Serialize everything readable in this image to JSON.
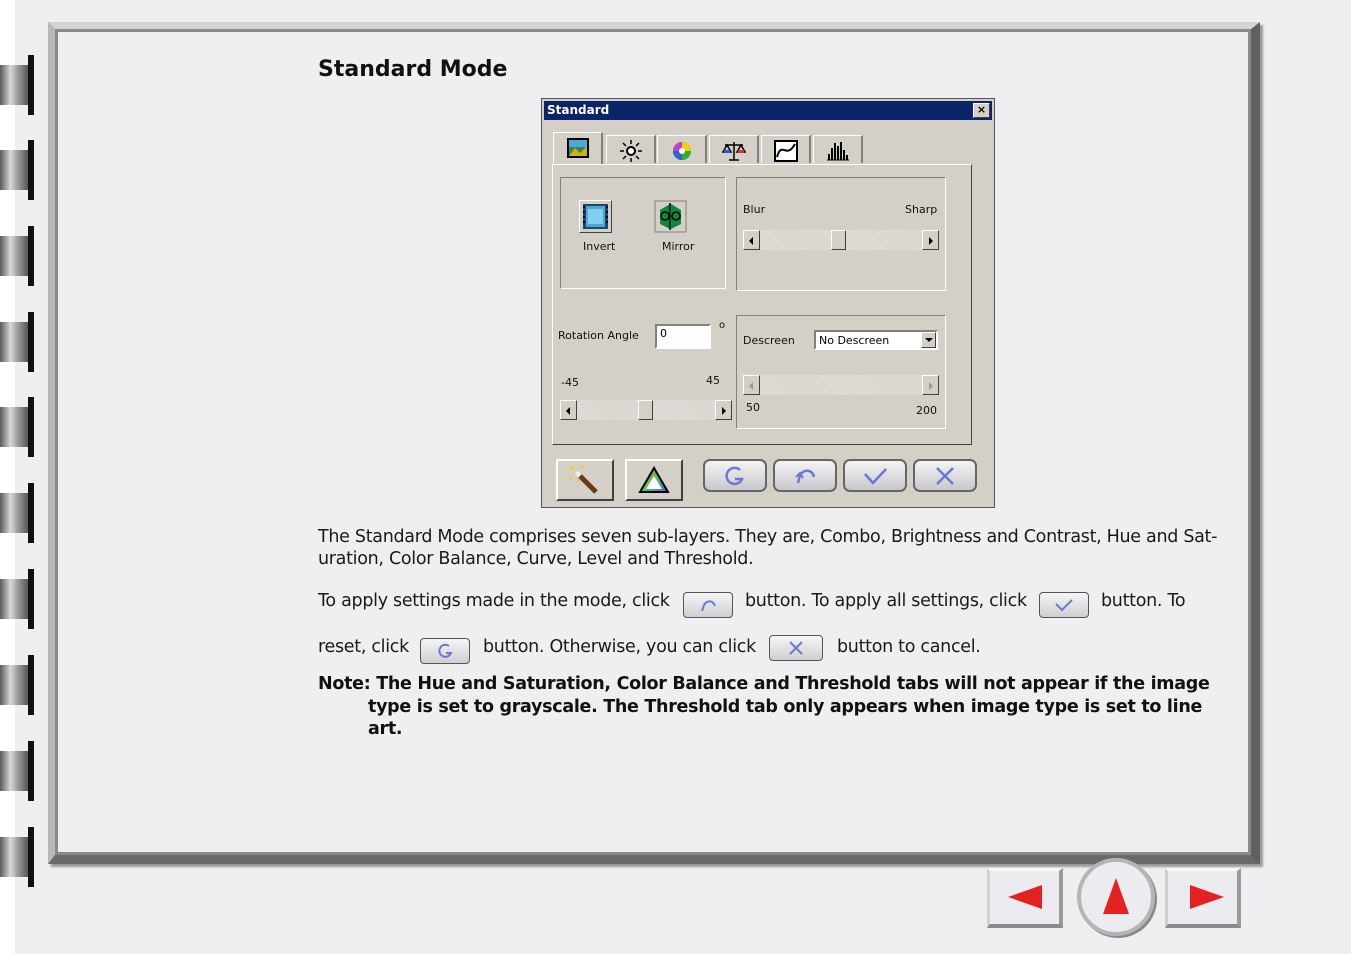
{
  "heading": "Standard Mode",
  "dialog": {
    "title": "Standard",
    "close": "×",
    "tabs": [
      "combo-icon",
      "brightness-contrast-icon",
      "hue-saturation-icon",
      "color-balance-icon",
      "curve-icon",
      "level-icon"
    ],
    "invert_label": "Invert",
    "mirror_label": "Mirror",
    "blur_label": "Blur",
    "sharp_label": "Sharp",
    "rotation_label": "Rotation Angle",
    "rotation_value": "0",
    "degree_symbol": "o",
    "rot_min": "-45",
    "rot_max": "45",
    "descreen_label": "Descreen",
    "descreen_value": "No Descreen",
    "descreen_min": "50",
    "descreen_max": "200"
  },
  "body": {
    "para1": "The Standard Mode comprises seven sub-layers. They are, Combo, Brightness and Contrast, Hue and Sat-",
    "para1b": "uration, Color Balance, Curve, Level and Threshold.",
    "p2a": "To apply settings made in the mode, click",
    "p2b": "button. To apply all settings, click",
    "p2c": "button. To",
    "p3a": "reset, click",
    "p3b": "button. Otherwise, you can click",
    "p3c": "button to cancel."
  },
  "note": {
    "line1": "Note: The Hue and Saturation, Color Balance and Threshold tabs will not appear if the image",
    "line2": "type is set to grayscale. The Threshold tab only appears when image type is set to line",
    "line3": "art."
  },
  "nav": {
    "prev": "previous-page-icon",
    "up": "up-icon",
    "next": "next-page-icon"
  },
  "colors": {
    "accent_red": "#e52222",
    "title_bar": "#0a246a"
  }
}
